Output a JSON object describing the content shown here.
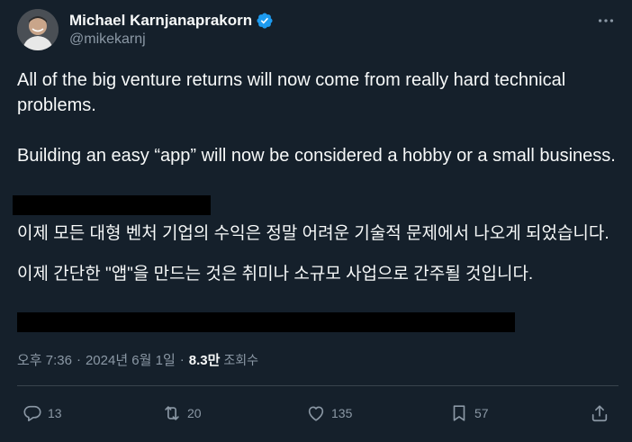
{
  "author": {
    "display_name": "Michael Karnjanaprakorn",
    "handle": "@mikekarnj",
    "verified": true,
    "verified_icon": "verified-badge-icon",
    "verified_color": "#1d9bf0"
  },
  "tweet": {
    "paragraph_1": "All of the big venture returns will now come from really hard technical problems.",
    "paragraph_2": "Building an easy “app” will now be considered a hobby or a small business.",
    "translation_1": "이제 모든 대형 벤처 기업의 수익은 정말 어려운 기술적 문제에서 나오게 되었습니다.",
    "translation_2": "이제 간단한 \"앱\"을 만드는 것은 취미나 소규모 사업으로 간주될 것입니다."
  },
  "meta": {
    "time": "오후 7:36",
    "separator": "·",
    "date": "2024년 6월 1일",
    "views_count": "8.3만",
    "views_label": "조회수"
  },
  "actions": {
    "reply_count": "13",
    "retweet_count": "20",
    "like_count": "135",
    "bookmark_count": "57"
  },
  "colors": {
    "background": "#15202b",
    "text_primary": "#f7f9f9",
    "text_secondary": "#8b98a5",
    "divider": "#38444d",
    "redaction": "#000000"
  }
}
